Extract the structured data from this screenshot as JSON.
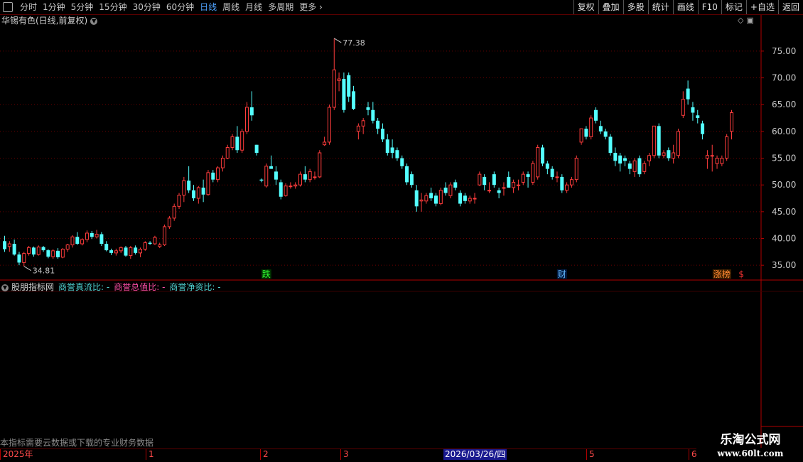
{
  "toolbar": {
    "timeframes": [
      "分时",
      "1分钟",
      "5分钟",
      "15分钟",
      "30分钟",
      "60分钟",
      "日线",
      "周线",
      "月线",
      "多周期",
      "更多"
    ],
    "active_timeframe": "日线",
    "right_tools": [
      "复权",
      "叠加",
      "多股",
      "统计",
      "画线",
      "F10",
      "标记",
      "+自选",
      "返回"
    ]
  },
  "main_title": "华锡有色(日线,前复权)",
  "sub_title": {
    "name": "股朋指标网",
    "series": [
      "商誉真流比: -",
      "商誉总值比: -",
      "商誉净资比: -"
    ]
  },
  "notice": "本指标需要云数据或下载的专业财务数据",
  "price_labels": {
    "high": "77.38",
    "low": "34.81"
  },
  "event_markers": [
    {
      "text": "跌",
      "color": "#33ff33",
      "bg": "#003300",
      "index": 54
    },
    {
      "text": "财",
      "color": "#66bbff",
      "bg": "#001a40",
      "index": 115
    },
    {
      "text": "涨榜",
      "color": "#ff8833",
      "bg": "#402000",
      "index": 148
    },
    {
      "text": "$",
      "color": "#ff3333",
      "bg": "",
      "index": 152
    }
  ],
  "timeline": {
    "labels": [
      {
        "text": "2025年",
        "x": 0
      },
      {
        "text": "1",
        "x": 205
      },
      {
        "text": "2",
        "x": 366
      },
      {
        "text": "3",
        "x": 479
      },
      {
        "text": "5",
        "x": 825
      },
      {
        "text": "6",
        "x": 969
      }
    ],
    "selected_date": "2026/03/26/四"
  },
  "watermark": {
    "line1": "乐淘公式网",
    "line2": "www.60lt.com"
  },
  "colors": {
    "up": "#ff3c3c",
    "down": "#54ffff",
    "grid": "#6a0000",
    "axis": "#c8c8c8"
  },
  "chart_data": {
    "type": "candlestick",
    "y_ticks": [
      35,
      40,
      45,
      50,
      55,
      60,
      65,
      70,
      75
    ],
    "y_tick_labels": [
      "35.00",
      "40.00",
      "45.00",
      "50.00",
      "55.00",
      "60.00",
      "65.00",
      "70.00",
      "75.00"
    ],
    "ylim": [
      32.5,
      79.5
    ],
    "ohlc": [
      [
        39.5,
        40.5,
        37.5,
        38.0
      ],
      [
        38.5,
        39.5,
        37.5,
        39.0
      ],
      [
        39.0,
        39.8,
        36.8,
        37.0
      ],
      [
        37.0,
        37.5,
        35.0,
        35.5
      ],
      [
        35.5,
        37.5,
        34.8,
        37.2
      ],
      [
        37.2,
        38.6,
        36.8,
        38.3
      ],
      [
        38.3,
        38.5,
        36.6,
        37.0
      ],
      [
        37.0,
        38.7,
        36.8,
        38.4
      ],
      [
        38.4,
        38.6,
        37.5,
        37.8
      ],
      [
        37.8,
        38.0,
        36.3,
        36.6
      ],
      [
        36.6,
        38.0,
        36.2,
        37.7
      ],
      [
        37.7,
        38.2,
        36.2,
        36.5
      ],
      [
        36.5,
        38.2,
        36.3,
        38.0
      ],
      [
        38.0,
        39.0,
        37.5,
        38.8
      ],
      [
        38.8,
        40.6,
        38.3,
        40.3
      ],
      [
        40.3,
        41.2,
        38.8,
        39.0
      ],
      [
        39.0,
        40.0,
        38.7,
        39.8
      ],
      [
        39.8,
        41.5,
        39.3,
        41.0
      ],
      [
        41.0,
        41.4,
        39.9,
        40.3
      ],
      [
        40.3,
        41.6,
        40.0,
        40.8
      ],
      [
        40.8,
        41.2,
        38.6,
        39.0
      ],
      [
        39.0,
        39.5,
        37.6,
        37.8
      ],
      [
        37.8,
        38.1,
        36.9,
        37.3
      ],
      [
        37.3,
        38.1,
        36.8,
        37.7
      ],
      [
        37.7,
        38.5,
        37.3,
        38.3
      ],
      [
        38.3,
        38.6,
        36.6,
        36.8
      ],
      [
        36.8,
        38.6,
        36.2,
        38.3
      ],
      [
        38.3,
        38.7,
        37.0,
        37.3
      ],
      [
        37.3,
        38.3,
        36.5,
        38.0
      ],
      [
        38.0,
        39.5,
        37.7,
        39.2
      ],
      [
        39.2,
        39.5,
        38.8,
        39.0
      ],
      [
        39.0,
        40.5,
        38.8,
        40.2
      ],
      [
        38.5,
        39.2,
        38.2,
        38.8
      ],
      [
        38.8,
        42.6,
        38.6,
        42.2
      ],
      [
        42.2,
        44.2,
        41.8,
        43.8
      ],
      [
        43.8,
        46.5,
        43.3,
        46.0
      ],
      [
        46.0,
        48.5,
        45.5,
        48.1
      ],
      [
        48.1,
        51.5,
        46.8,
        50.8
      ],
      [
        50.8,
        53.5,
        48.5,
        49.0
      ],
      [
        49.0,
        50.0,
        47.0,
        47.5
      ],
      [
        47.5,
        49.8,
        46.5,
        49.5
      ],
      [
        49.5,
        51.0,
        46.8,
        48.2
      ],
      [
        48.2,
        52.8,
        48.0,
        52.3
      ],
      [
        52.3,
        52.8,
        50.5,
        51.0
      ],
      [
        51.0,
        53.5,
        50.5,
        53.2
      ],
      [
        53.2,
        55.5,
        52.5,
        55.0
      ],
      [
        55.0,
        57.5,
        54.8,
        57.0
      ],
      [
        57.0,
        59.5,
        56.5,
        59.0
      ],
      [
        59.0,
        61.0,
        56.0,
        56.5
      ],
      [
        56.5,
        60.5,
        56.0,
        60.0
      ],
      [
        60.0,
        65.5,
        59.5,
        64.5
      ],
      [
        64.5,
        67.5,
        62.0,
        63.0
      ],
      [
        57.5,
        57.5,
        55.5,
        56.0
      ],
      [
        51.0,
        51.2,
        50.5,
        50.8
      ],
      [
        49.8,
        54.0,
        49.5,
        53.5
      ],
      [
        53.5,
        55.5,
        53.0,
        53.0
      ],
      [
        52.5,
        53.5,
        50.0,
        51.0
      ],
      [
        50.5,
        51.0,
        47.3,
        47.8
      ],
      [
        48.0,
        50.3,
        47.8,
        49.8
      ],
      [
        49.8,
        50.5,
        49.3,
        49.8
      ],
      [
        49.8,
        50.5,
        49.3,
        50.0
      ],
      [
        50.0,
        52.5,
        49.7,
        52.0
      ],
      [
        52.0,
        53.5,
        50.5,
        51.0
      ],
      [
        51.0,
        53.0,
        50.5,
        52.5
      ],
      [
        51.5,
        52.5,
        51.0,
        51.5
      ],
      [
        51.5,
        56.5,
        51.3,
        56.0
      ],
      [
        57.5,
        59.0,
        57.3,
        58.0
      ],
      [
        58.0,
        65.0,
        57.5,
        64.5
      ],
      [
        64.5,
        77.38,
        64.0,
        71.5
      ],
      [
        69.5,
        71.0,
        67.5,
        69.8
      ],
      [
        69.8,
        71.0,
        63.5,
        64.0
      ],
      [
        70.5,
        71.0,
        65.5,
        66.5
      ],
      [
        67.5,
        68.5,
        64.0,
        64.2
      ],
      [
        60.0,
        61.5,
        58.5,
        61.0
      ],
      [
        61.0,
        62.5,
        59.5,
        62.0
      ],
      [
        64.5,
        65.5,
        63.0,
        64.0
      ],
      [
        64.0,
        65.5,
        61.5,
        62.0
      ],
      [
        62.0,
        62.5,
        59.5,
        60.5
      ],
      [
        60.5,
        61.5,
        58.0,
        58.5
      ],
      [
        58.5,
        59.5,
        55.5,
        56.0
      ],
      [
        57.0,
        58.5,
        55.0,
        56.0
      ],
      [
        56.5,
        57.0,
        54.5,
        55.0
      ],
      [
        55.0,
        55.5,
        53.0,
        53.5
      ],
      [
        53.5,
        54.0,
        50.0,
        50.5
      ],
      [
        52.0,
        52.5,
        49.5,
        50.0
      ],
      [
        49.0,
        50.0,
        45.0,
        46.0
      ],
      [
        47.0,
        48.5,
        45.0,
        47.2
      ],
      [
        47.0,
        48.5,
        46.5,
        48.0
      ],
      [
        48.5,
        49.5,
        47.0,
        47.5
      ],
      [
        48.0,
        48.5,
        46.0,
        46.5
      ],
      [
        46.5,
        49.5,
        46.2,
        49.0
      ],
      [
        49.5,
        50.5,
        48.0,
        48.5
      ],
      [
        48.0,
        50.5,
        47.5,
        50.0
      ],
      [
        50.5,
        51.0,
        49.0,
        49.5
      ],
      [
        48.5,
        49.0,
        46.0,
        46.5
      ],
      [
        48.0,
        48.5,
        46.5,
        47.0
      ],
      [
        47.0,
        48.0,
        46.5,
        47.5
      ],
      [
        47.5,
        48.5,
        46.5,
        47.5
      ],
      [
        50.0,
        52.5,
        49.8,
        52.0
      ],
      [
        51.5,
        52.0,
        49.0,
        50.0
      ],
      [
        49.0,
        50.5,
        48.5,
        49.0
      ],
      [
        52.0,
        52.5,
        49.5,
        50.0
      ],
      [
        49.0,
        49.5,
        47.5,
        48.5
      ],
      [
        49.5,
        50.5,
        48.0,
        49.5
      ],
      [
        51.5,
        52.5,
        49.5,
        49.5
      ],
      [
        49.5,
        51.0,
        48.5,
        50.5
      ],
      [
        50.0,
        51.0,
        49.0,
        50.0
      ],
      [
        50.5,
        52.5,
        50.0,
        52.0
      ],
      [
        52.0,
        52.5,
        49.5,
        51.5
      ],
      [
        50.5,
        54.5,
        50.0,
        54.0
      ],
      [
        51.5,
        57.5,
        51.0,
        57.0
      ],
      [
        57.0,
        57.5,
        53.5,
        54.0
      ],
      [
        54.0,
        54.5,
        52.0,
        53.0
      ],
      [
        53.0,
        53.5,
        51.0,
        51.5
      ],
      [
        51.5,
        52.5,
        50.5,
        51.5
      ],
      [
        51.5,
        52.0,
        48.5,
        49.0
      ],
      [
        49.0,
        50.5,
        48.5,
        50.0
      ],
      [
        50.0,
        51.5,
        49.5,
        51.0
      ],
      [
        51.0,
        55.5,
        50.5,
        55.0
      ],
      [
        58.0,
        60.5,
        57.5,
        60.5
      ],
      [
        60.5,
        61.0,
        58.5,
        59.0
      ],
      [
        59.0,
        63.0,
        58.5,
        62.5
      ],
      [
        64.0,
        64.5,
        61.5,
        62.0
      ],
      [
        61.0,
        62.0,
        59.5,
        60.0
      ],
      [
        60.0,
        60.5,
        58.5,
        59.0
      ],
      [
        59.0,
        59.5,
        55.5,
        56.0
      ],
      [
        56.0,
        57.0,
        53.5,
        54.5
      ],
      [
        55.5,
        56.0,
        52.5,
        54.0
      ],
      [
        55.0,
        55.5,
        53.5,
        54.5
      ],
      [
        54.0,
        54.5,
        52.0,
        53.0
      ],
      [
        52.5,
        55.0,
        51.5,
        54.5
      ],
      [
        55.0,
        55.5,
        51.5,
        52.0
      ],
      [
        52.5,
        54.5,
        52.0,
        54.0
      ],
      [
        54.5,
        56.0,
        53.5,
        55.5
      ],
      [
        55.5,
        61.0,
        55.0,
        61.0
      ],
      [
        61.0,
        61.5,
        55.0,
        55.5
      ],
      [
        55.5,
        56.5,
        55.0,
        56.0
      ],
      [
        56.5,
        57.0,
        54.5,
        55.0
      ],
      [
        55.0,
        57.5,
        54.0,
        56.0
      ],
      [
        55.5,
        60.5,
        55.0,
        60.0
      ],
      [
        63.0,
        67.5,
        62.5,
        66.0
      ],
      [
        68.0,
        69.5,
        65.0,
        66.0
      ],
      [
        64.5,
        65.5,
        62.0,
        63.5
      ],
      [
        63.0,
        64.0,
        61.5,
        62.5
      ],
      [
        61.5,
        62.0,
        58.5,
        59.5
      ],
      [
        55.0,
        56.5,
        53.0,
        55.5
      ],
      [
        55.5,
        57.5,
        52.5,
        55.5
      ],
      [
        54.0,
        55.5,
        53.0,
        55.0
      ],
      [
        54.0,
        55.5,
        53.5,
        55.0
      ],
      [
        55.0,
        59.5,
        54.5,
        59.0
      ],
      [
        60.0,
        64.0,
        58.5,
        63.5
      ]
    ]
  }
}
